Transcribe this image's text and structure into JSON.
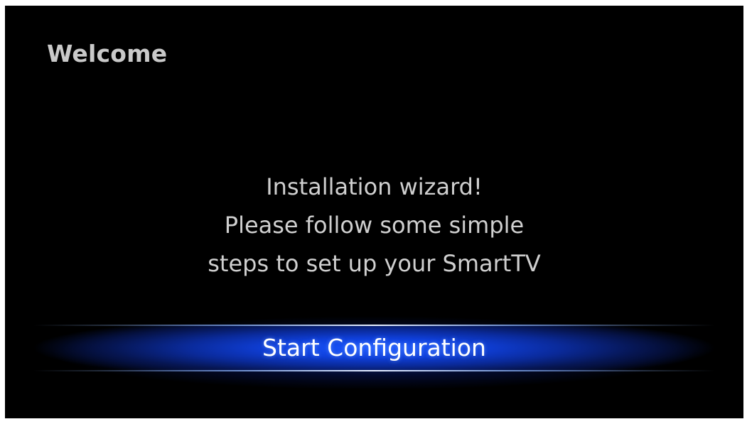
{
  "header": {
    "title": "Welcome"
  },
  "message": {
    "lines": [
      "Installation wizard!",
      "Please follow some simple",
      "steps to set up your SmartTV"
    ]
  },
  "actions": {
    "start_label": "Start Configuration"
  },
  "colors": {
    "background": "#000000",
    "title_text": "#c9c9c9",
    "body_text": "#cfcfcf",
    "button_accent": "#1b57ff",
    "button_text": "#ffffff"
  }
}
